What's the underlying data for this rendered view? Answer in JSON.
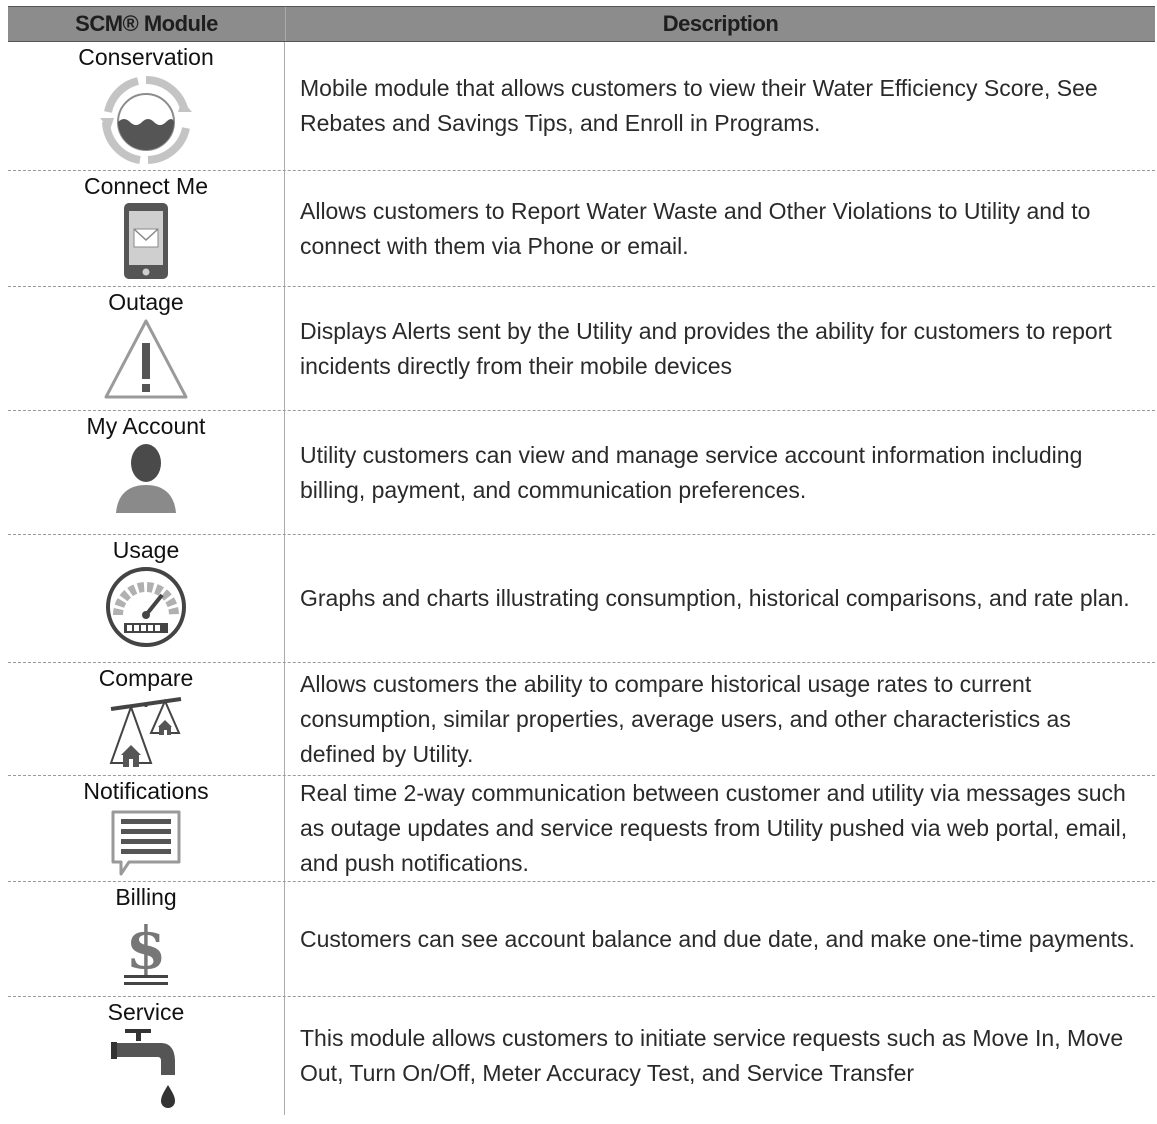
{
  "header": {
    "module": "SCM® Module",
    "description": "Description"
  },
  "rows": [
    {
      "name": "Conservation",
      "icon": "water-recycle-icon",
      "description": "Mobile module that allows customers to view their Water Efficiency Score, See Rebates and Savings Tips, and Enroll in Programs."
    },
    {
      "name": "Connect Me",
      "icon": "phone-mail-icon",
      "description": "Allows customers to Report Water Waste and Other Violations to Utility and to connect with them via Phone or email."
    },
    {
      "name": "Outage",
      "icon": "warning-triangle-icon",
      "description": "Displays Alerts sent by the Utility and provides the ability for customers to report incidents directly from their mobile devices"
    },
    {
      "name": "My Account",
      "icon": "user-silhouette-icon",
      "description": "Utility customers can view and manage service account information including billing, payment, and communication preferences."
    },
    {
      "name": "Usage",
      "icon": "gauge-meter-icon",
      "description": "Graphs and charts illustrating consumption, historical comparisons, and rate plan."
    },
    {
      "name": "Compare",
      "icon": "balance-houses-icon",
      "description": "Allows customers the ability to compare historical usage rates to current consumption, similar properties, average users, and other characteristics as defined by Utility."
    },
    {
      "name": "Notifications",
      "icon": "message-bubble-icon",
      "description": "Real time 2-way communication between customer and utility via messages such as outage updates and service requests from Utility pushed via web portal, email, and push notifications."
    },
    {
      "name": "Billing",
      "icon": "dollar-sign-icon",
      "description": "Customers can see account balance and due date, and make one-time payments."
    },
    {
      "name": "Service",
      "icon": "faucet-drip-icon",
      "description": "This module allows customers to initiate service requests such as Move In, Move Out, Turn On/Off, Meter Accuracy Test, and Service Transfer"
    }
  ]
}
